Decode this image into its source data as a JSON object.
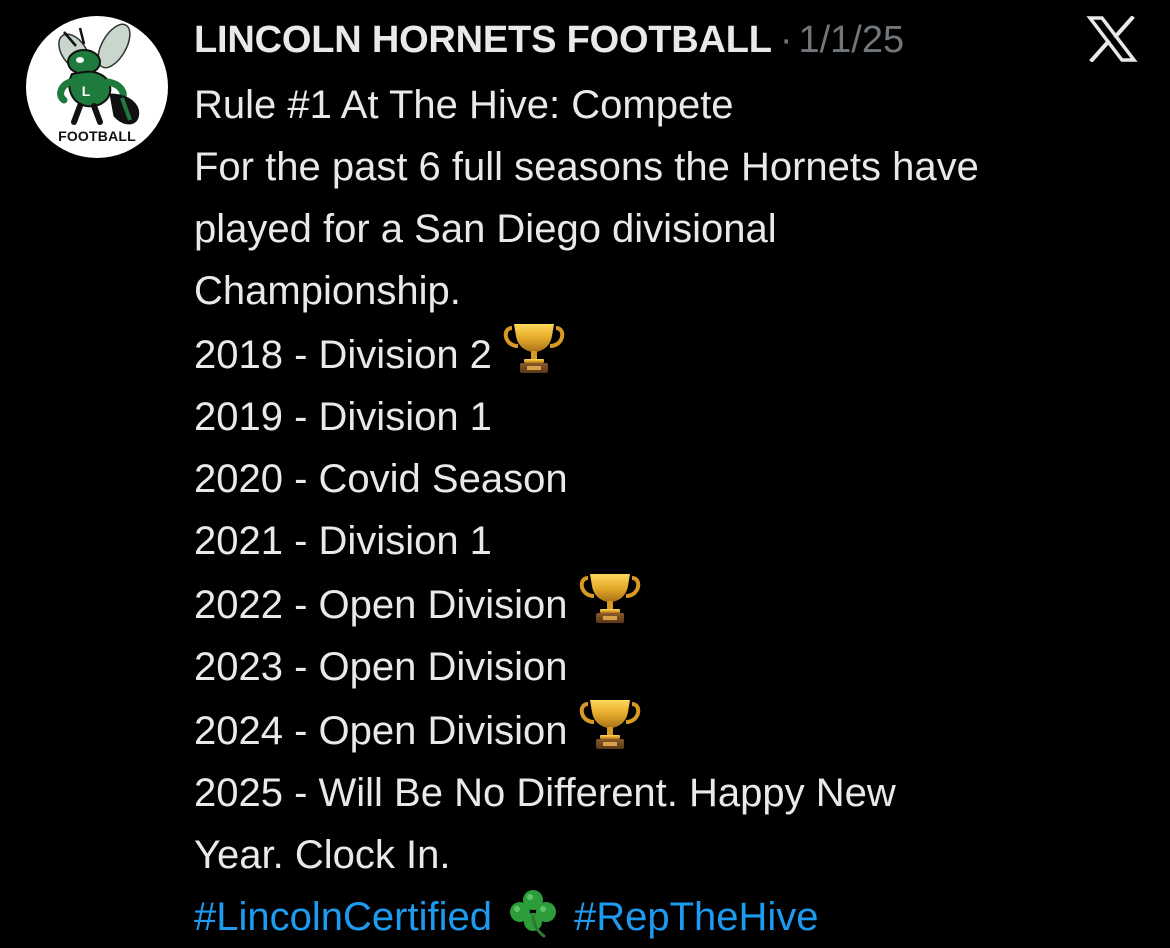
{
  "post": {
    "avatar": {
      "label": "FOOTBALL",
      "icon": "hornet-mascot-icon"
    },
    "author": "LINCOLN HORNETS FOOTBALL",
    "separator": "·",
    "date": "1/1/25",
    "platform_icon": "x-logo-icon",
    "lines": [
      "Rule #1 At The Hive: Compete",
      "For the past 6 full seasons the Hornets have",
      "played for a San Diego divisional",
      "Championship.",
      "2018 - Division 2",
      "2019 - Division 1",
      "2020 - Covid Season",
      "2021 - Division 1",
      "2022 - Open Division",
      "2023 - Open Division",
      "2024 - Open Division",
      "2025 - Will Be No Different. Happy New",
      "Year. Clock In."
    ],
    "trophy_icon": "trophy-icon",
    "hashtags": [
      "#LincolnCertified",
      "#RepTheHive"
    ],
    "separator_icon": "shamrock-icon"
  },
  "colors": {
    "background": "#000000",
    "text": "#e7e9ea",
    "muted": "#71767b",
    "link": "#1d9bf0",
    "brand_green": "#1f7a3e"
  }
}
